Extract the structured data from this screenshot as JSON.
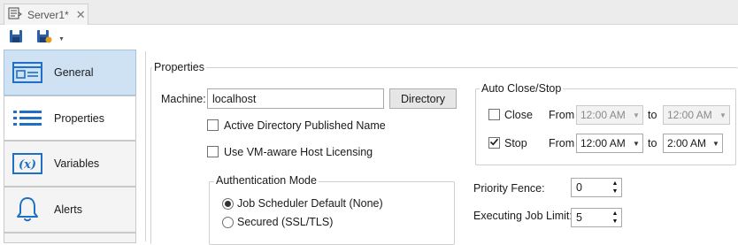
{
  "document_tab": {
    "title": "Server1*",
    "close_glyph": "✕"
  },
  "toolbar": {
    "save_icon": "save-icon",
    "save_as_icon": "save-options-icon",
    "dropdown_glyph": "▼"
  },
  "nav": {
    "items": [
      {
        "label": "General",
        "icon": "general-form-icon",
        "active": true
      },
      {
        "label": "Properties",
        "icon": "list-icon",
        "active": false
      },
      {
        "label": "Variables",
        "icon": "variables-icon",
        "active": false
      },
      {
        "label": "Alerts",
        "icon": "bell-icon",
        "active": false
      }
    ]
  },
  "properties": {
    "title": "Properties",
    "machine_label": "Machine:",
    "machine_value": "localhost",
    "directory_button": "Directory",
    "active_directory_label": "Active Directory Published Name",
    "active_directory_checked": false,
    "vm_aware_label": "Use VM-aware Host Licensing",
    "vm_aware_checked": false
  },
  "auth_mode": {
    "title": "Authentication Mode",
    "options": [
      {
        "label": "Job Scheduler Default (None)",
        "selected": true
      },
      {
        "label": "Secured (SSL/TLS)",
        "selected": false
      }
    ]
  },
  "auto_close_stop": {
    "title": "Auto Close/Stop",
    "rows": [
      {
        "label": "Close",
        "checked": false,
        "from_label": "From",
        "from": "12:00 AM",
        "to_label": "to",
        "to": "12:00 AM",
        "enabled": false
      },
      {
        "label": "Stop",
        "checked": true,
        "from_label": "From",
        "from": "12:00 AM",
        "to_label": "to",
        "to": "2:00 AM",
        "enabled": true
      }
    ]
  },
  "priority_fence": {
    "label": "Priority Fence:",
    "value": "0"
  },
  "executing_job_limit": {
    "label": "Executing Job Limit:",
    "value": "5"
  },
  "colors": {
    "accent": "#2b5fa8",
    "nav_active_bg": "#cfe2f4",
    "check_mark": "#1a1a1a"
  }
}
